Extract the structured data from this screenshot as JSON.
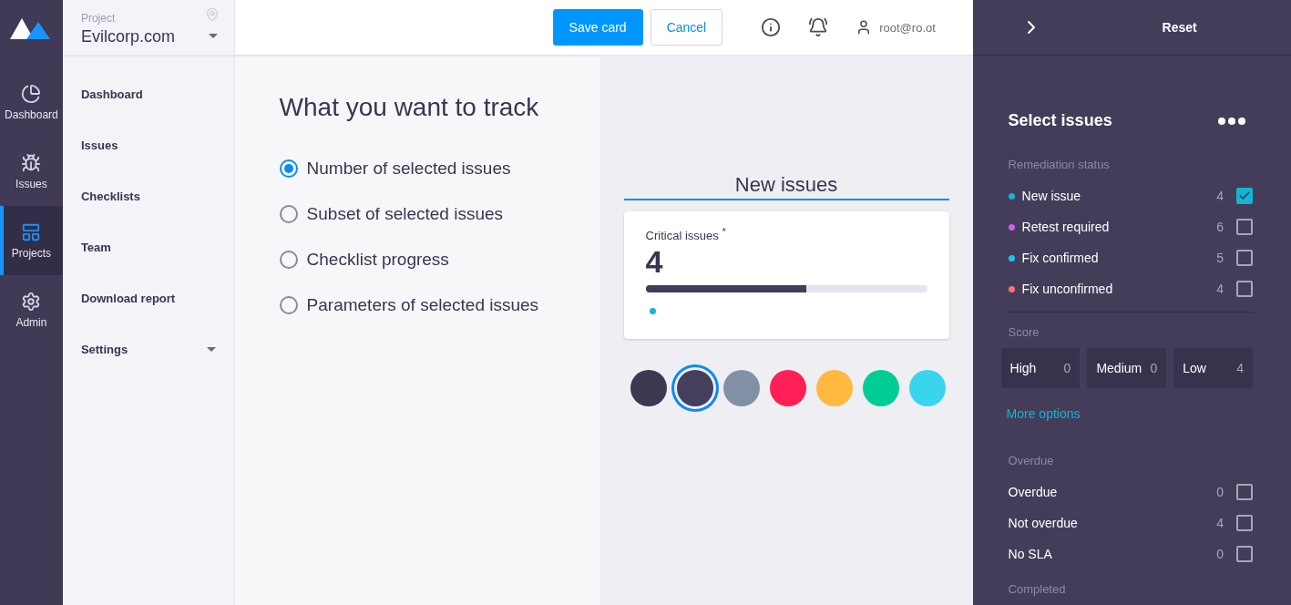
{
  "rail": [
    {
      "label": "Dashboard",
      "selected": false
    },
    {
      "label": "Issues",
      "selected": false
    },
    {
      "label": "Projects",
      "selected": true
    },
    {
      "label": "Admin",
      "selected": false
    }
  ],
  "project": {
    "label": "Project",
    "name": "Evilcorp.com"
  },
  "nav": [
    {
      "label": "Dashboard",
      "expandable": false
    },
    {
      "label": "Issues",
      "expandable": false
    },
    {
      "label": "Checklists",
      "expandable": false
    },
    {
      "label": "Team",
      "expandable": false
    },
    {
      "label": "Download report",
      "expandable": false
    },
    {
      "label": "Settings",
      "expandable": true
    }
  ],
  "header": {
    "save": "Save card",
    "cancel": "Cancel",
    "user": "root@ro.ot"
  },
  "track": {
    "title": "What you want to track",
    "options": [
      {
        "label": "Number of selected issues",
        "selected": true
      },
      {
        "label": "Subset of selected issues",
        "selected": false
      },
      {
        "label": "Checklist progress",
        "selected": false
      },
      {
        "label": "Parameters of selected issues",
        "selected": false
      }
    ]
  },
  "preview": {
    "name": "New issues",
    "card": {
      "title": "Critical issues",
      "mark": "*",
      "value": "4",
      "level": 0.57,
      "color": "#12b5d4"
    },
    "swatches": [
      {
        "color": "#3d3851",
        "selected": false
      },
      {
        "color": "#443f5c",
        "selected": true
      },
      {
        "color": "#8290a6",
        "selected": false
      },
      {
        "color": "#ff1f57",
        "selected": false
      },
      {
        "color": "#ffb93f",
        "selected": false
      },
      {
        "color": "#00cc96",
        "selected": false
      },
      {
        "color": "#39d5ef",
        "selected": false
      }
    ]
  },
  "panel": {
    "reset": "Reset",
    "title": "Select issues",
    "sections": [
      {
        "title": "Remediation status",
        "kind": "checks",
        "rows": [
          {
            "label": "New issue",
            "count": "4",
            "checked": true,
            "color": "#12b5d4"
          },
          {
            "label": "Retest required",
            "count": "6",
            "checked": false,
            "color": "#d55ce8"
          },
          {
            "label": "Fix confirmed",
            "count": "5",
            "checked": false,
            "color": "#1ec2f0"
          },
          {
            "label": "Fix unconfirmed",
            "count": "4",
            "checked": false,
            "color": "#ff7373"
          }
        ]
      },
      {
        "title": "Score",
        "kind": "tiles",
        "tiles": [
          {
            "label": "High",
            "count": "0"
          },
          {
            "label": "Medium",
            "count": "0"
          },
          {
            "label": "Low",
            "count": "4"
          }
        ],
        "link": "More options"
      },
      {
        "title": "Overdue",
        "kind": "checks",
        "rows": [
          {
            "label": "Overdue",
            "count": "0",
            "checked": false
          },
          {
            "label": "Not overdue",
            "count": "4",
            "checked": false
          },
          {
            "label": "No SLA",
            "count": "0",
            "checked": false
          }
        ]
      },
      {
        "title": "Completed",
        "kind": "checks"
      }
    ]
  }
}
